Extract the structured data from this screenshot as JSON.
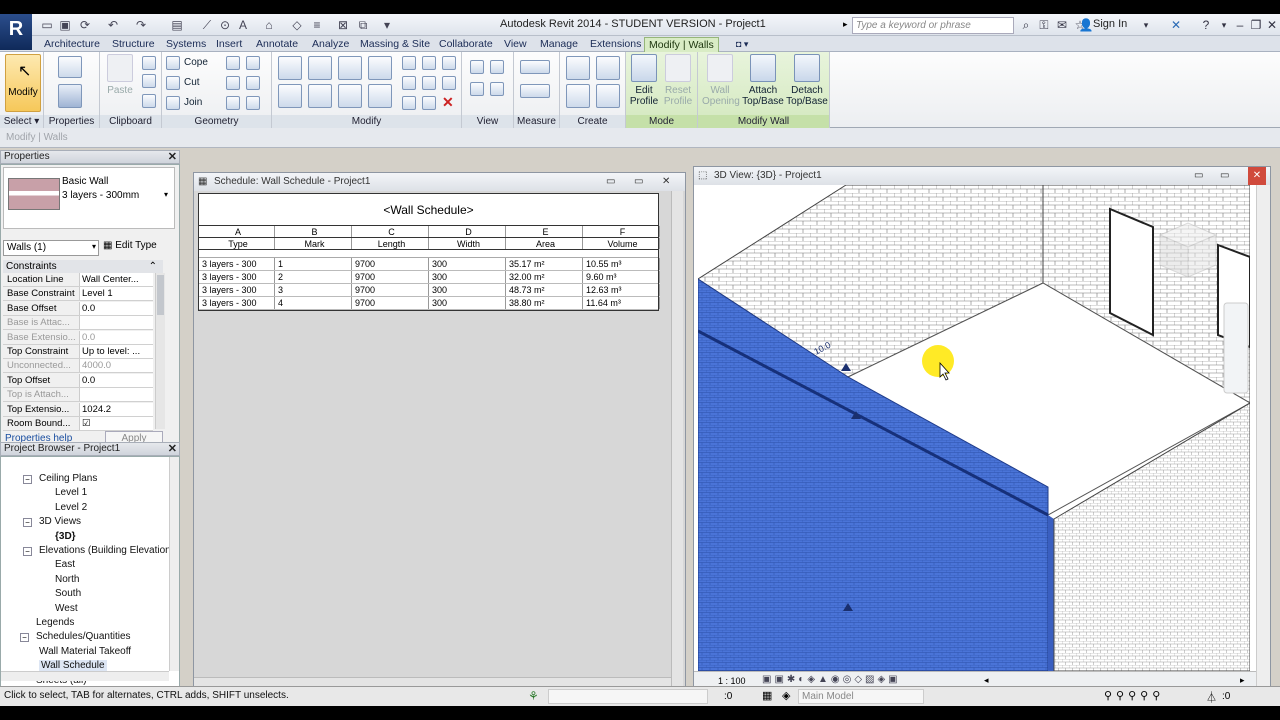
{
  "app": {
    "logo_letter": "R",
    "title": "Autodesk Revit 2014 - STUDENT VERSION -   Project1",
    "search_placeholder": "Type a keyword or phrase",
    "sign_in": "Sign In"
  },
  "tabs": [
    "Architecture",
    "Structure",
    "Systems",
    "Insert",
    "Annotate",
    "Analyze",
    "Massing & Site",
    "Collaborate",
    "View",
    "Manage",
    "Extensions",
    "Modify | Walls"
  ],
  "ribbon": {
    "modify_label": "Modify",
    "paste_label": "Paste",
    "cope_label": "Cope",
    "cut_label": "Cut",
    "join_label": "Join",
    "edit_profile": [
      "Edit",
      "Profile"
    ],
    "reset_profile": [
      "Reset",
      "Profile"
    ],
    "wall_opening": [
      "Wall",
      "Opening"
    ],
    "attach": [
      "Attach",
      "Top/Base"
    ],
    "detach": [
      "Detach",
      "Top/Base"
    ],
    "groups": [
      "Select",
      "Properties",
      "Clipboard",
      "Geometry",
      "Modify",
      "View",
      "Measure",
      "Create",
      "Mode",
      "Modify Wall"
    ]
  },
  "option_bar": "Modify | Walls",
  "properties": {
    "panel_title": "Properties",
    "type_name": "Basic Wall",
    "type_sub": "3 layers - 300mm",
    "instance_filter": "Walls (1)",
    "edit_type": "Edit Type",
    "section": "Constraints",
    "rows": [
      {
        "k": "Location Line",
        "v": "Wall Center...",
        "grey": false
      },
      {
        "k": "Base Constraint",
        "v": "Level 1",
        "grey": false
      },
      {
        "k": "Base Offset",
        "v": "0.0",
        "grey": false
      },
      {
        "k": "Base is Attac...",
        "v": "",
        "grey": true
      },
      {
        "k": "Base Extensio...",
        "v": "0.0",
        "grey": true
      },
      {
        "k": "Top Constraint",
        "v": "Up to level: ...",
        "grey": false
      },
      {
        "k": "Unconnected...",
        "v": "4000.0",
        "grey": true
      },
      {
        "k": "Top Offset",
        "v": "0.0",
        "grey": false
      },
      {
        "k": "Top is Attach...",
        "v": "",
        "grey": true
      },
      {
        "k": "Top Extensio...",
        "v": "1024.2",
        "grey": false
      },
      {
        "k": "Room Bound...",
        "v": "☑",
        "grey": false
      }
    ],
    "help": "Properties help",
    "apply": "Apply"
  },
  "browser": {
    "title": "Project Browser - Project1",
    "items": [
      {
        "t": "Ceiling Plans",
        "x": 38,
        "tog": "−"
      },
      {
        "t": "Level 1",
        "x": 54,
        "tog": ""
      },
      {
        "t": "Level 2",
        "x": 54,
        "tog": ""
      },
      {
        "t": "3D Views",
        "x": 38,
        "tog": "−"
      },
      {
        "t": "{3D}",
        "x": 54,
        "tog": ""
      },
      {
        "t": "Elevations (Building Elevation",
        "x": 38,
        "tog": "−"
      },
      {
        "t": "East",
        "x": 54,
        "tog": ""
      },
      {
        "t": "North",
        "x": 54,
        "tog": ""
      },
      {
        "t": "South",
        "x": 54,
        "tog": ""
      },
      {
        "t": "West",
        "x": 54,
        "tog": ""
      },
      {
        "t": "Legends",
        "x": 35,
        "tog": ""
      },
      {
        "t": "Schedules/Quantities",
        "x": 35,
        "tog": "−"
      },
      {
        "t": "Wall Material Takeoff",
        "x": 38,
        "tog": ""
      },
      {
        "t": "Wall Schedule",
        "x": 38,
        "tog": ""
      },
      {
        "t": "Sheets (all)",
        "x": 35,
        "tog": ""
      }
    ]
  },
  "schedule": {
    "window_title": "Schedule: Wall Schedule - Project1",
    "table_title": "<Wall Schedule>",
    "letters": [
      "A",
      "B",
      "C",
      "D",
      "E",
      "F"
    ],
    "headers": [
      "Type",
      "Mark",
      "Length",
      "Width",
      "Area",
      "Volume"
    ],
    "rows": [
      [
        "3 layers - 300",
        "1",
        "9700",
        "300",
        "35.17 m²",
        "10.55 m³"
      ],
      [
        "3 layers - 300",
        "2",
        "9700",
        "300",
        "32.00 m²",
        "9.60 m³"
      ],
      [
        "3 layers - 300",
        "3",
        "9700",
        "300",
        "48.73 m²",
        "12.63 m³"
      ],
      [
        "3 layers - 300",
        "4",
        "9700",
        "300",
        "38.80 m²",
        "11.64 m³"
      ]
    ]
  },
  "view3d": {
    "window_title": "3D View: {3D} - Project1",
    "scale": "1 : 100",
    "dim_label": "10.0"
  },
  "status": {
    "message": "Click to select, TAB for alternates, CTRL adds, SHIFT unselects.",
    "worksets": ":0",
    "model": "Main Model",
    "filter_count": ":0"
  }
}
